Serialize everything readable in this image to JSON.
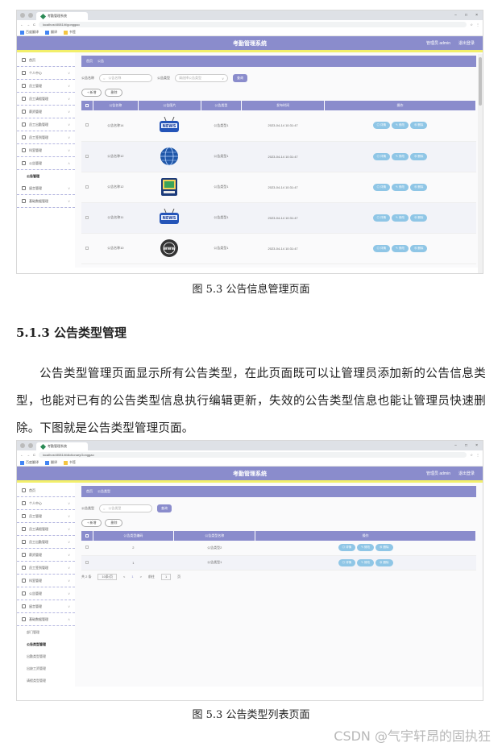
{
  "heading": "5.1.3 公告类型管理",
  "paragraph": "公告类型管理页面显示所有公告类型，在此页面既可以让管理员添加新的公告信息类型，也能对已有的公告类型信息执行编辑更新，失效的公告类型信息也能让管理员快速删除。下图就是公告类型管理页面。",
  "caption1": "图 5.3  公告信息管理页面",
  "caption2": "图 5.3  公告类型列表页面",
  "watermark": "CSDN @气宇轩昂的固执狂",
  "browser": {
    "tab_title": "考勤管理系统",
    "win_min": "−",
    "win_max": "□",
    "win_close": "×",
    "menu": "⋮",
    "url1": "localhost:8081/#/gonggao",
    "url2": "localhost:8081/#/dictionaryGonggao",
    "bookmarks": [
      "百度翻译",
      "翻译",
      "书签"
    ],
    "nav_back": "←",
    "nav_fwd": "→",
    "nav_reload": "C",
    "nav_star": "☆"
  },
  "app": {
    "title": "考勤管理系统",
    "admin": "管理员 admin",
    "logout": "退出登录"
  },
  "sidebar1": {
    "items": [
      "首页",
      "个人中心",
      "员工管理",
      "员工请假管理",
      "薪资管理",
      "员工出勤管理",
      "员工签到管理",
      "科室管理",
      "公告管理",
      "留言管理",
      "基础数据管理"
    ],
    "sub": "公告管理"
  },
  "sidebar2": {
    "items": [
      "首页",
      "个人中心",
      "员工管理",
      "员工请假管理",
      "员工出勤管理",
      "薪资管理",
      "员工签到管理",
      "科室管理",
      "公告管理",
      "留言管理",
      "基础数据管理"
    ],
    "subs": [
      "部门管理",
      "公告类型管理",
      "出勤类型管理",
      "出缺工资管理",
      "请假类型管理"
    ]
  },
  "shot1": {
    "crumb": [
      "首页",
      "公告"
    ],
    "search_label1": "公告名称",
    "search_ph1": "公告名称",
    "search_label2": "公告类型",
    "search_ph2": "请选择公告类型",
    "search_btn": "查询",
    "btn_add": "+ 新增",
    "btn_del": "删除",
    "headers": [
      "",
      "公告名称",
      "公告图片",
      "公告类型",
      "发布时间",
      "操作"
    ],
    "rows": [
      {
        "name": "公告名称14",
        "type": "公告类型1",
        "time": "2023-04-14 10:31:47",
        "img": "news"
      },
      {
        "name": "公告名称12",
        "type": "公告类型1",
        "time": "2023-04-14 10:31:47",
        "img": "globe"
      },
      {
        "name": "公告名称12",
        "type": "公告类型1",
        "time": "2023-04-14 10:31:47",
        "img": "board"
      },
      {
        "name": "公告名称11",
        "type": "公告类型1",
        "time": "2023-04-14 10:31:47",
        "img": "news"
      },
      {
        "name": "公告名称10",
        "type": "公告类型1",
        "time": "2023-04-14 10:31:47",
        "img": "www"
      }
    ],
    "ops": [
      "详情",
      "修改",
      "删除"
    ]
  },
  "shot2": {
    "crumb": [
      "首页",
      "公告类型"
    ],
    "search_label": "公告类型",
    "search_ph": "公告类型",
    "search_btn": "查询",
    "btn_add": "+ 新增",
    "btn_del": "删除",
    "headers": [
      "",
      "公告类型编码",
      "公告类型名称",
      "操作"
    ],
    "rows": [
      {
        "code": "2",
        "name": "公告类型2"
      },
      {
        "code": "1",
        "name": "公告类型1"
      }
    ],
    "ops": [
      "详情",
      "修改",
      "删除"
    ],
    "pager": {
      "total": "共 2 条",
      "size": "10条/页",
      "prev": "<",
      "page": "1",
      "next": ">",
      "goto": "前往",
      "goto_val": "1",
      "unit": "页"
    }
  }
}
